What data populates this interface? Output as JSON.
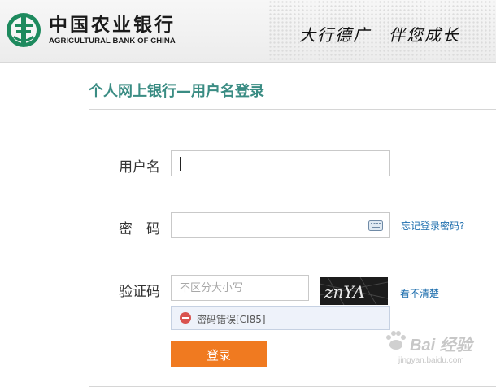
{
  "header": {
    "bank_name_cn": "中国农业银行",
    "bank_name_en": "AGRICULTURAL BANK OF CHINA",
    "slogan_left": "大行德广",
    "slogan_right": "伴您成长"
  },
  "page": {
    "title": "个人网上银行—用户名登录"
  },
  "form": {
    "username_label": "用户名",
    "username_value": "",
    "password_label": "密　码",
    "password_value": "",
    "forgot_password": "忘记登录密码?",
    "captcha_label": "验证码",
    "captcha_placeholder": "不区分大小写",
    "captcha_text": "znYA",
    "captcha_refresh": "看不清楚",
    "error_message": "密码错误[CI85]",
    "login_button": "登录"
  },
  "watermark": {
    "main": "Bai 经验",
    "sub": "jingyan.baidu.com"
  },
  "colors": {
    "title": "#3a8c83",
    "link": "#1f6fae",
    "button": "#f07a20",
    "error": "#d9534f",
    "logo": "#1e8a5e"
  },
  "icons": {
    "logo": "abc-logo-icon",
    "keyboard": "keyboard-icon",
    "error": "error-icon"
  }
}
